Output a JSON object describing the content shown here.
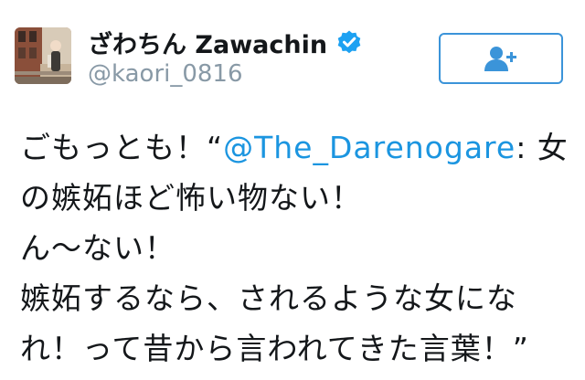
{
  "user": {
    "display_name": "ざわちん Zawachin",
    "handle": "@kaori_0816",
    "verified": true
  },
  "follow_button": {
    "icon": "follow-user-plus-icon"
  },
  "tweet": {
    "line1_prefix": "ごもっとも！“",
    "mention": "@The_Darenogare",
    "line1_suffix": ": 女",
    "line2": "の嫉妬ほど怖い物ない！",
    "line3": "ん〜ない！",
    "line4": "嫉妬するなら、されるような女にな",
    "line5": "れ！って昔から言われてきた言葉！”"
  },
  "colors": {
    "accent": "#1b95e0",
    "handle_gray": "#8899a6",
    "text": "#14171a"
  }
}
